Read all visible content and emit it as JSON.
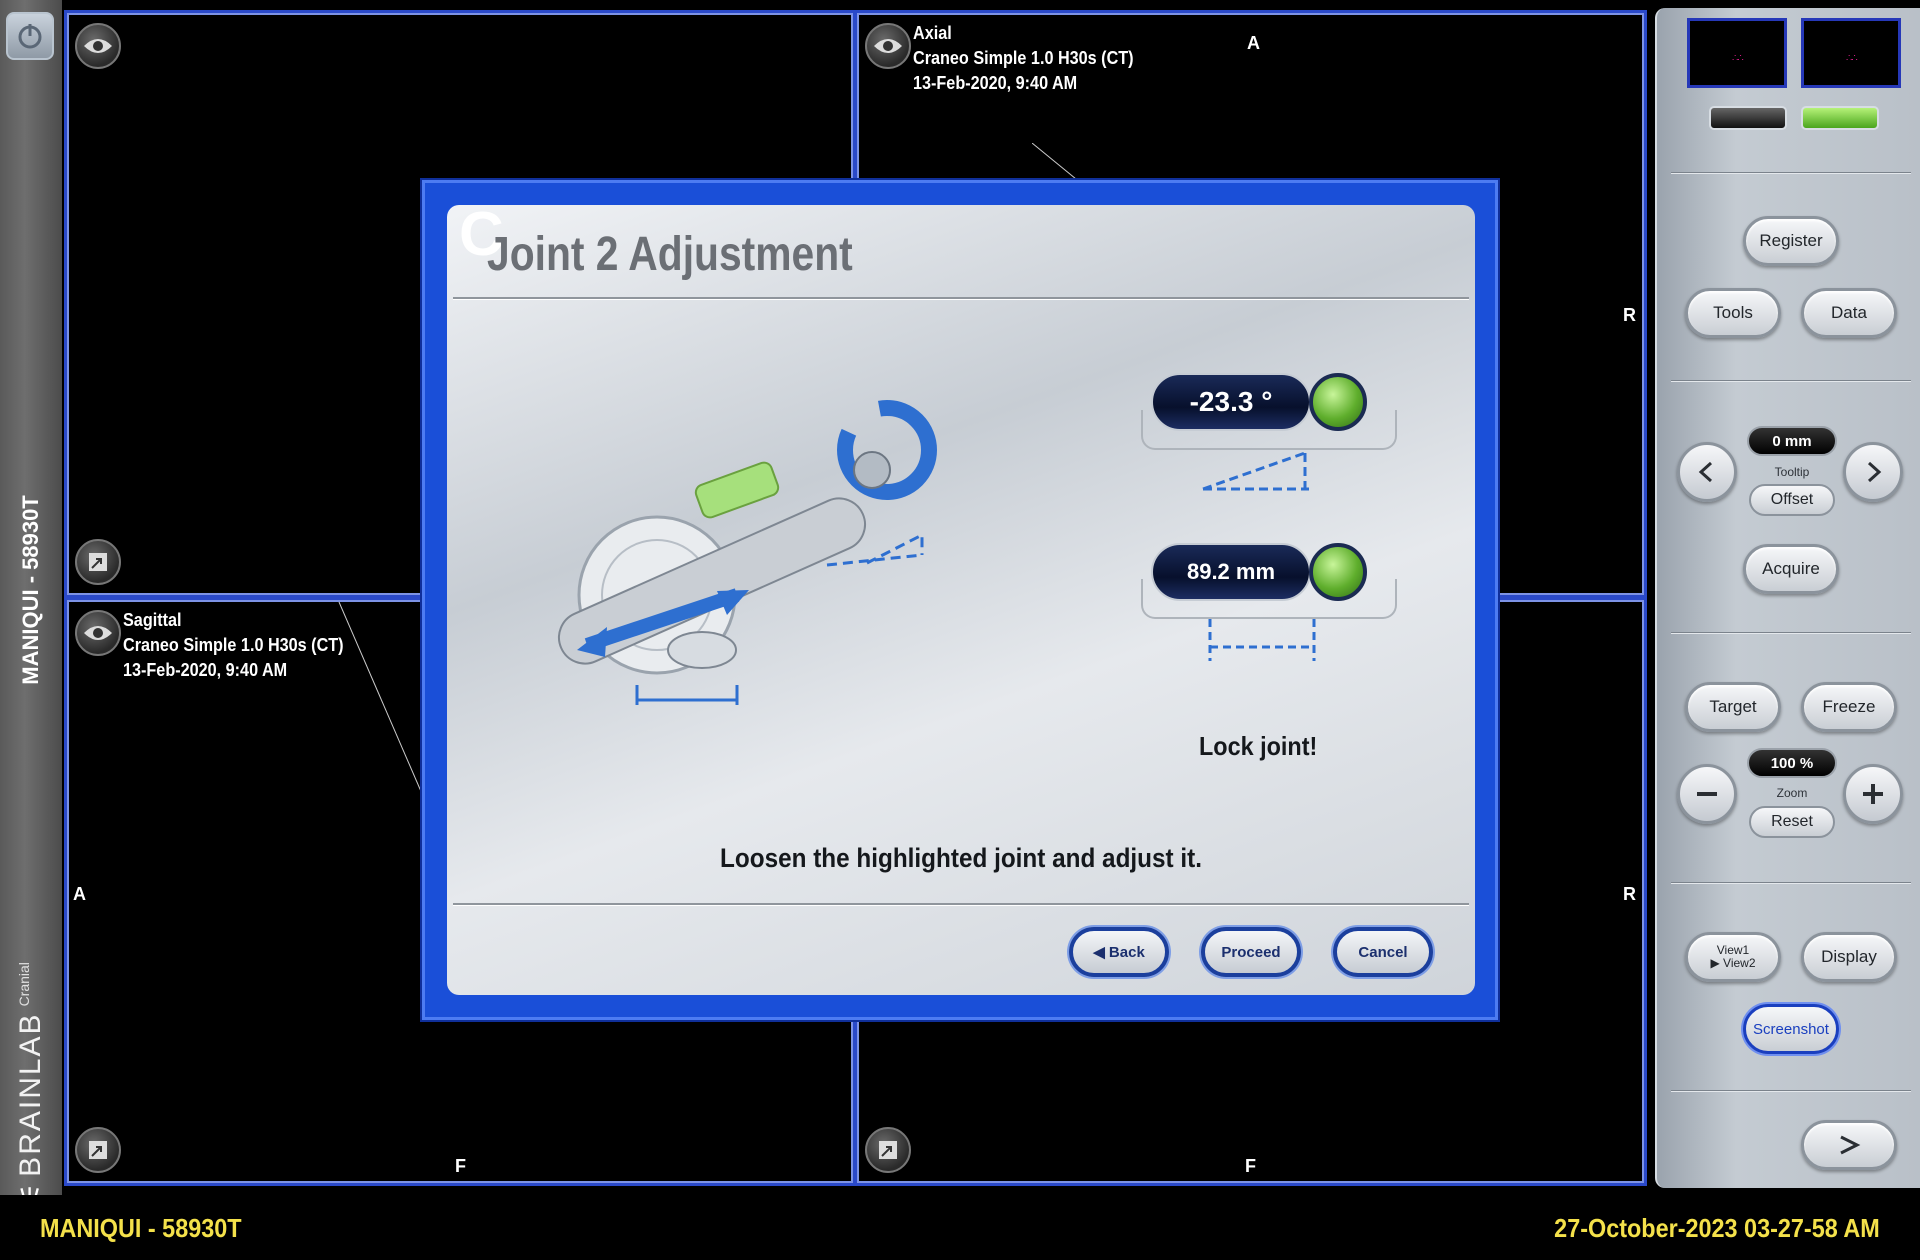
{
  "left_strip": {
    "patient_id": "MANIQUI - 58930T",
    "brand": "BRAINLAB",
    "brand_sub": "Cranial"
  },
  "viewports": {
    "top_left": {},
    "axial": {
      "name": "Axial",
      "series": "Craneo Simple  1.0  H30s (CT)",
      "date": "13-Feb-2020, 9:40 AM",
      "orient_top": "A",
      "orient_right": "R"
    },
    "sagittal": {
      "name": "Sagittal",
      "series": "Craneo Simple  1.0  H30s (CT)",
      "date": "13-Feb-2020, 9:40 AM",
      "orient_left": "A",
      "orient_bottom": "F"
    },
    "bottom_right": {
      "orient_right": "R",
      "orient_bottom": "F"
    }
  },
  "dialog": {
    "letter": "C",
    "title": "Joint 2 Adjustment",
    "angle_value": "-23.3 °",
    "distance_value": "89.2 mm",
    "lock_text": "Lock joint!",
    "instruction": "Loosen the highlighted joint and adjust it.",
    "buttons": {
      "back": "◀ Back",
      "proceed": "Proceed",
      "cancel": "Cancel"
    }
  },
  "right_panel": {
    "register": "Register",
    "tools": "Tools",
    "data": "Data",
    "tooltip_value": "0 mm",
    "tooltip_label": "Tooltip",
    "offset": "Offset",
    "acquire": "Acquire",
    "target": "Target",
    "freeze": "Freeze",
    "zoom_value": "100 %",
    "zoom_label": "Zoom",
    "reset": "Reset",
    "view1": "View1",
    "view2": "▶ View2",
    "display": "Display",
    "screenshot": "Screenshot"
  },
  "status_bar": {
    "patient_id": "MANIQUI - 58930T",
    "datetime": "27-October-2023  03-27-58 AM"
  },
  "colors": {
    "viewport_border": "#2a49c9",
    "status_text": "#f4e14a",
    "led_green": "#5fae2c",
    "dialog_frame": "#1a4fd8"
  }
}
